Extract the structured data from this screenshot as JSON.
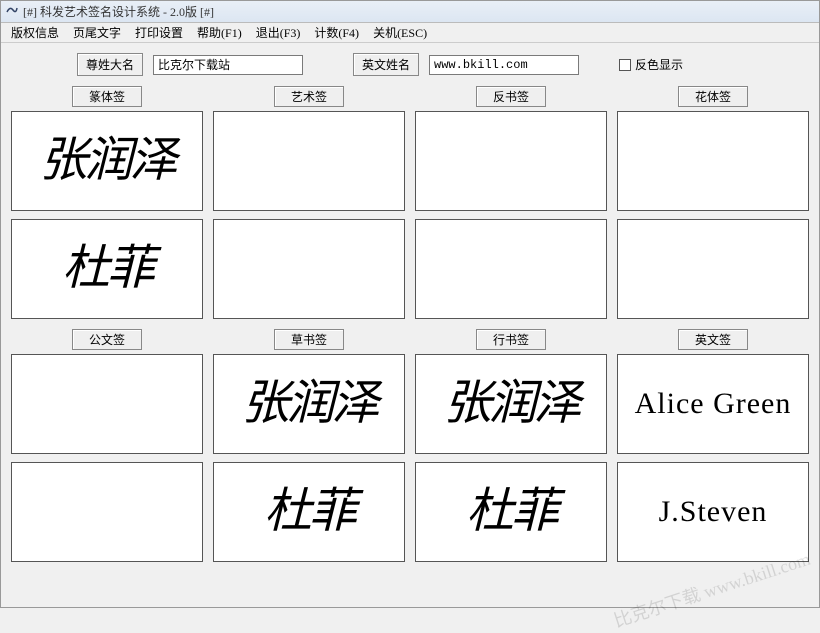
{
  "window": {
    "title": "[#] 科发艺术签名设计系统 - 2.0版 [#]"
  },
  "menu": {
    "items": [
      "版权信息",
      "页尾文字",
      "打印设置",
      "帮助(F1)",
      "退出(F3)",
      "计数(F4)",
      "关机(ESC)"
    ]
  },
  "inputs": {
    "name_label": "尊姓大名",
    "name_value": "比克尔下载站",
    "en_label": "英文姓名",
    "en_value": "www.bkill.com",
    "invert_label": "反色显示",
    "invert_checked": false
  },
  "panels": {
    "row1": [
      {
        "label": "篆体签",
        "slot1": "张润泽",
        "slot2": "杜菲",
        "style": "stylized"
      },
      {
        "label": "艺术签",
        "slot1": "",
        "slot2": ""
      },
      {
        "label": "反书签",
        "slot1": "",
        "slot2": ""
      },
      {
        "label": "花体签",
        "slot1": "",
        "slot2": ""
      }
    ],
    "row2": [
      {
        "label": "公文签",
        "slot1": "",
        "slot2": ""
      },
      {
        "label": "草书签",
        "slot1": "张润泽",
        "slot2": "杜菲",
        "style": "stylized"
      },
      {
        "label": "行书签",
        "slot1": "张润泽",
        "slot2": "杜菲",
        "style": "stylized"
      },
      {
        "label": "英文签",
        "slot1": "Alice Green",
        "slot2": "J.Steven",
        "style": "en"
      }
    ]
  },
  "watermark": "比克尔下载 www.bkill.com"
}
